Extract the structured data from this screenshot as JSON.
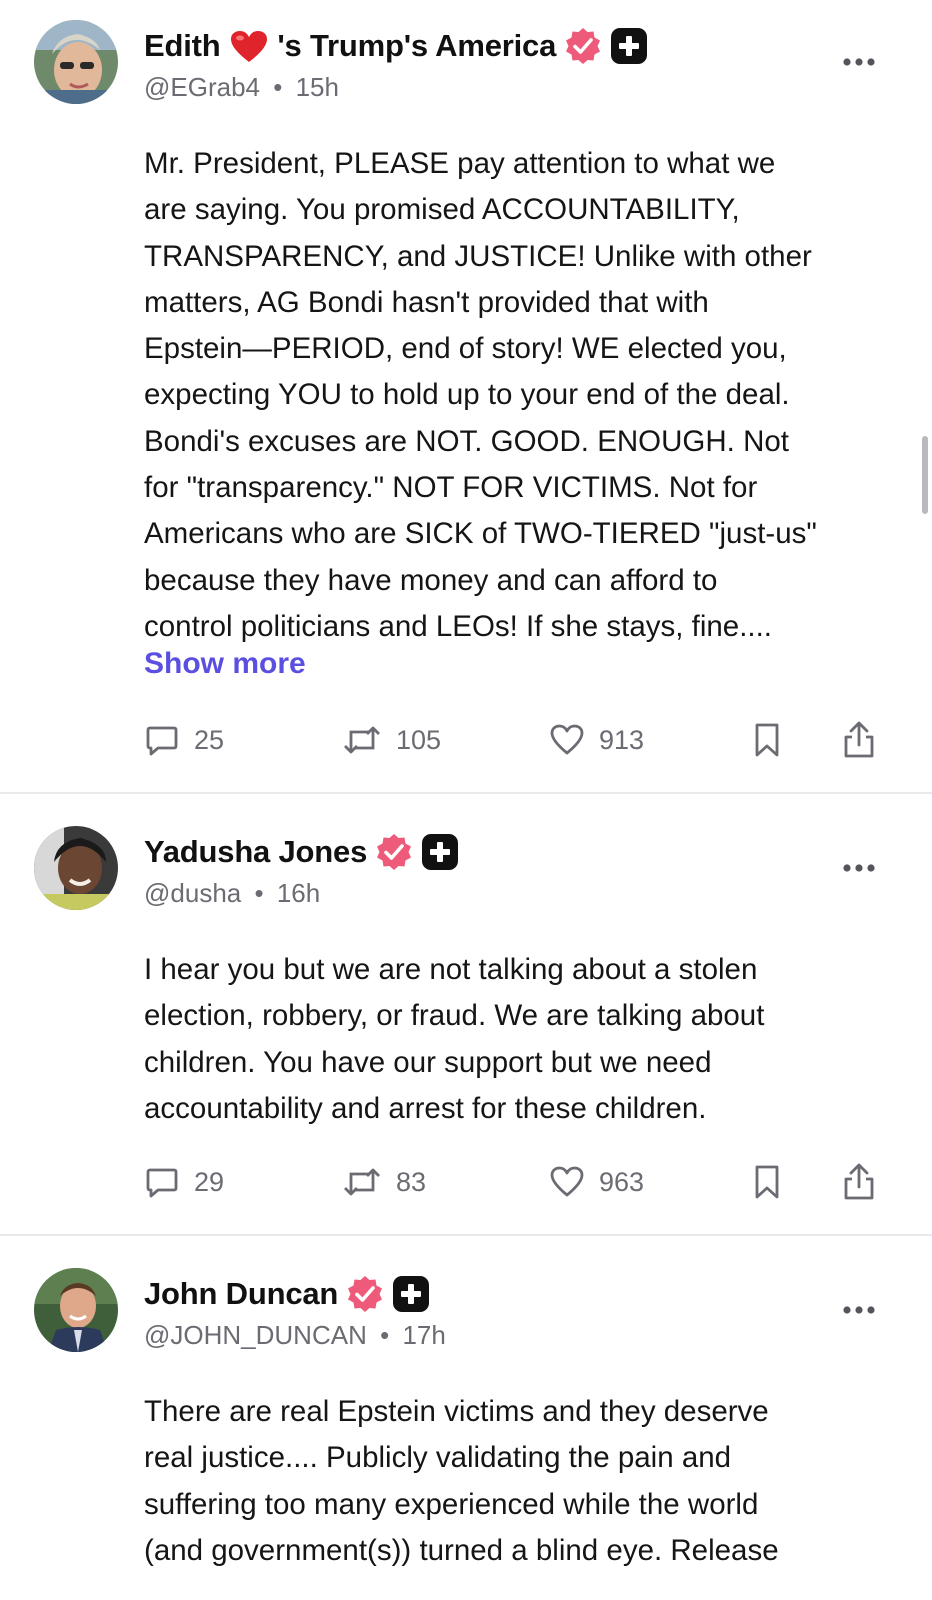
{
  "posts": [
    {
      "name_before": "Edith",
      "name_after": "'s Trump's America",
      "handle": "@EGrab4",
      "time": "15h",
      "text": "Mr. President, PLEASE pay attention to what we\nare saying. You promised ACCOUNTABILITY,\nTRANSPARENCY, and JUSTICE! Unlike with other\nmatters, AG Bondi hasn't provided that with\nEpstein—PERIOD, end of story! WE elected you,\nexpecting YOU to hold up to your end of the deal.\nBondi's excuses are NOT. GOOD. ENOUGH. Not\nfor \"transparency.\" NOT FOR VICTIMS. Not for\nAmericans who are SICK of TWO-TIERED \"just-us\"\nbecause they have money and can afford to\ncontrol politicians and LEOs! If she stays, fine....",
      "show_more": "Show more",
      "replies": "25",
      "reposts": "105",
      "likes": "913"
    },
    {
      "name": "Yadusha Jones",
      "handle": "@dusha",
      "time": "16h",
      "text": "I hear you but we are not talking about a stolen\nelection, robbery, or fraud. We are talking about\nchildren. You have our support but we need\naccountability and arrest for these children.",
      "replies": "29",
      "reposts": "83",
      "likes": "963"
    },
    {
      "name": "John Duncan",
      "handle": "@JOHN_DUNCAN",
      "time": "17h",
      "text": "There are real Epstein victims and they deserve\nreal justice.... Publicly validating the pain and\nsuffering too many experienced while the world\n(and government(s)) turned a blind eye. Release"
    }
  ],
  "separator": "•",
  "colors": {
    "verified_badge": "#ee5a7a",
    "plus_badge": "#111111",
    "show_more": "#5b4fe0",
    "muted_text": "#6b6b73"
  },
  "icons": [
    "heart-emoji",
    "verified-badge-icon",
    "plus-badge-icon",
    "more-icon",
    "reply-icon",
    "repost-icon",
    "like-icon",
    "bookmark-icon",
    "share-icon"
  ]
}
